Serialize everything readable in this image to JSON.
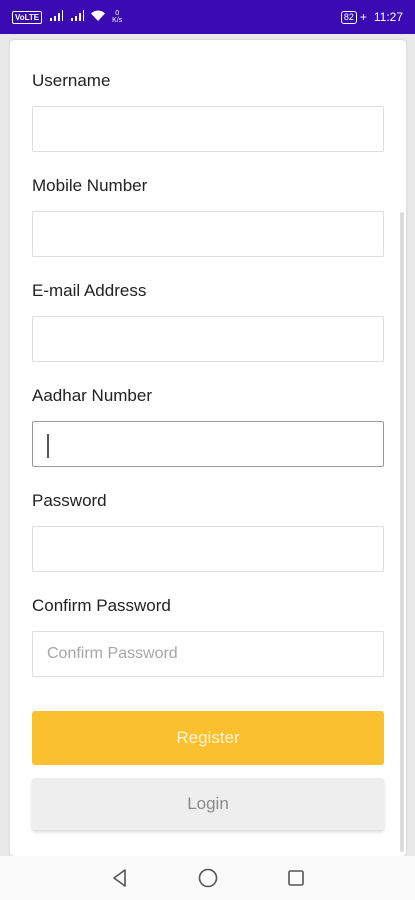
{
  "status_bar": {
    "volte": "VoLTE",
    "net_speed_value": "0",
    "net_speed_unit": "K/s",
    "battery": "82",
    "time": "11:27"
  },
  "form": {
    "fields": [
      {
        "label": "Username",
        "value": "",
        "placeholder": ""
      },
      {
        "label": "Mobile Number",
        "value": "",
        "placeholder": ""
      },
      {
        "label": "E-mail Address",
        "value": "",
        "placeholder": ""
      },
      {
        "label": "Aadhar Number",
        "value": "",
        "placeholder": ""
      },
      {
        "label": "Password",
        "value": "",
        "placeholder": ""
      },
      {
        "label": "Confirm Password",
        "value": "",
        "placeholder": "Confirm Password"
      }
    ],
    "register_label": "Register",
    "login_label": "Login"
  },
  "colors": {
    "status_bar": "#3a0ab3",
    "register_button": "#fbc02d",
    "login_button": "#eeeeee"
  },
  "nav_icons": [
    "back-icon",
    "home-icon",
    "recents-icon"
  ]
}
